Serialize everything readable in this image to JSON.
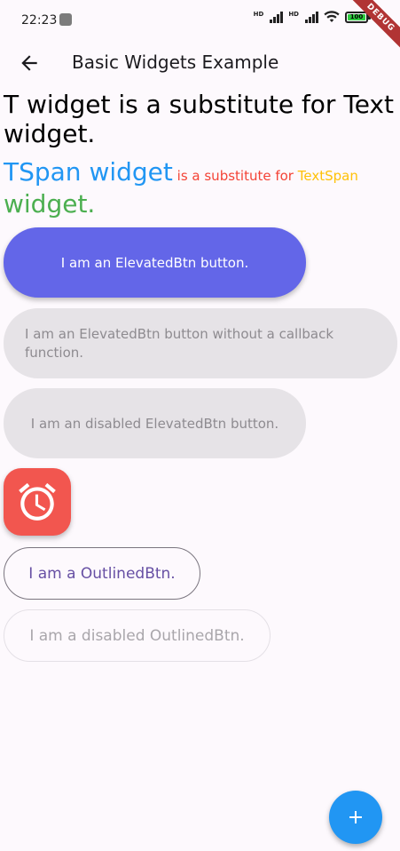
{
  "status_bar": {
    "time": "22:23",
    "hd_label_1": "HD",
    "hd_label_2": "HD",
    "battery": "100",
    "debug": "DEBUG"
  },
  "app_bar": {
    "title": "Basic Widgets Example",
    "back_icon": "arrow-back-icon"
  },
  "t_widget_text": "T widget is a substitute for Text widget.",
  "tspan": {
    "part1": "TSpan widget",
    "part2": " is a substitute for ",
    "part3": "TextSpan",
    "part4": " widget."
  },
  "buttons": {
    "elevated": "I am an ElevatedBtn button.",
    "elevated_no_callback": "I am an ElevatedBtn button without a callback function.",
    "elevated_disabled": "I am an disabled ElevatedBtn button.",
    "alarm_icon": "alarm-icon",
    "outlined": "I am a OutlinedBtn.",
    "outlined_disabled": "I am a disabled OutlinedBtn.",
    "fab_icon": "add-icon"
  },
  "colors": {
    "primary_button": "#6366e8",
    "alarm_button": "#f2564f",
    "fab": "#2196f3",
    "tspan_blue": "#2196f3",
    "tspan_red": "#f44336",
    "tspan_yellow": "#ffc107",
    "tspan_green": "#4caf50"
  }
}
